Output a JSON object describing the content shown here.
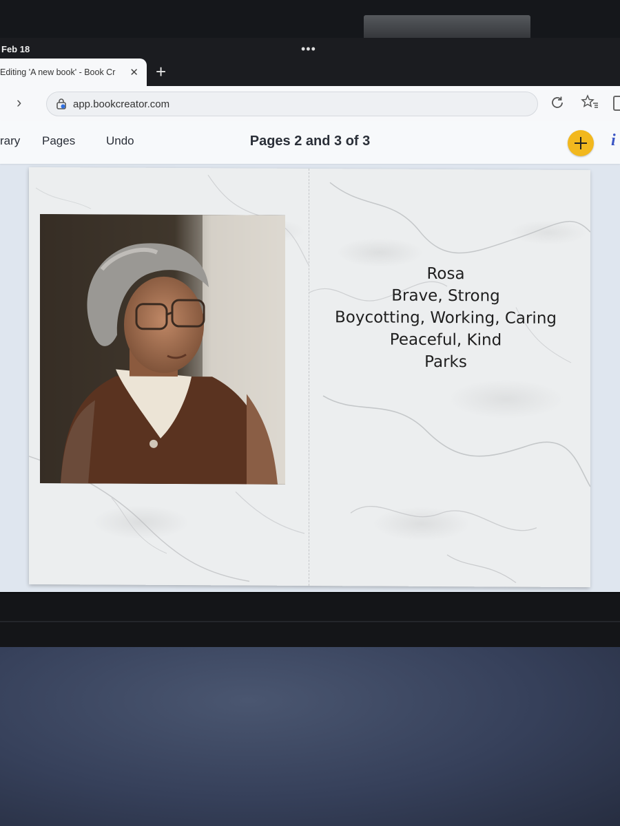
{
  "status_bar": {
    "date": "Feb 18",
    "multitask": "•••"
  },
  "browser": {
    "tab": {
      "title": "Editing 'A new book' - Book Cr",
      "close": "✕"
    },
    "new_tab": "+",
    "forward": "›",
    "url": "app.bookcreator.com"
  },
  "app_header": {
    "library_label": "rary",
    "pages_label": "Pages",
    "undo_label": "Undo",
    "title": "Pages 2 and 3 of 3",
    "add_icon": "plus-icon",
    "info_label": "i"
  },
  "book": {
    "left_page": {
      "image": "portrait-photo"
    },
    "right_page": {
      "lines": [
        "Rosa",
        "Brave, Strong",
        "Boycotting, Working, Caring",
        "Peaceful, Kind",
        "Parks"
      ]
    }
  },
  "colors": {
    "accent_button": "#f2b81e",
    "info_icon": "#3b56c4",
    "page_background": "#eceeef"
  }
}
